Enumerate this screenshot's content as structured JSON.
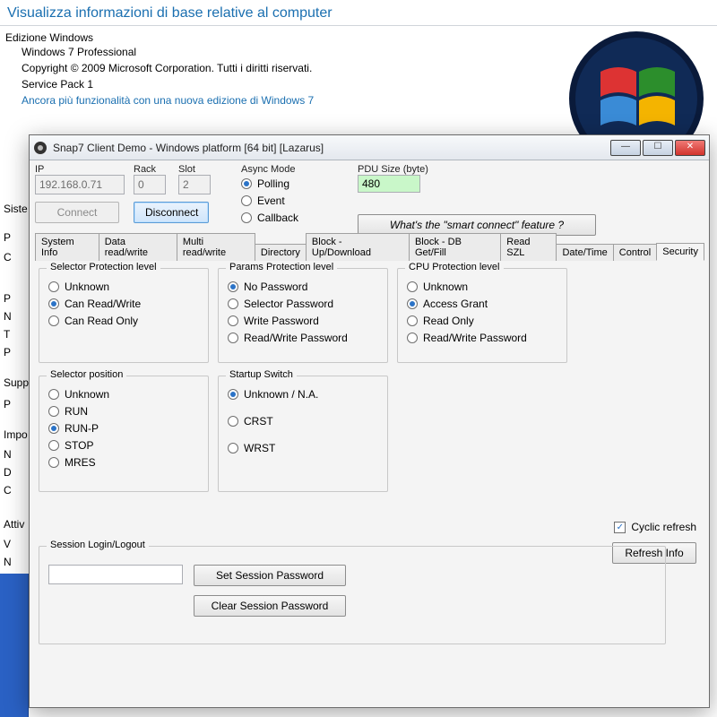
{
  "bg": {
    "title": "Visualizza informazioni di base relative al computer",
    "edition_header": "Edizione Windows",
    "os": "Windows 7 Professional",
    "copyright": "Copyright © 2009 Microsoft Corporation. Tutti i diritti riservati.",
    "sp": "Service Pack 1",
    "more_link": "Ancora più funzionalità con una nuova edizione di Windows 7",
    "side": [
      "Siste",
      "P",
      "C",
      "P",
      "N",
      "T",
      "P",
      "Supp",
      "P",
      "Impo",
      "N",
      "D",
      "C",
      "Attiv",
      "V",
      "N"
    ]
  },
  "win": {
    "title": "Snap7 Client Demo - Windows platform [64 bit] [Lazarus]"
  },
  "toprow": {
    "ip_label": "IP",
    "ip_value": "192.168.0.71",
    "rack_label": "Rack",
    "rack_value": "0",
    "slot_label": "Slot",
    "slot_value": "2",
    "connect_label": "Connect",
    "disconnect_label": "Disconnect",
    "async_label": "Async Mode",
    "async_options": [
      "Polling",
      "Event",
      "Callback"
    ],
    "async_selected": 0,
    "pdu_label": "PDU Size (byte)",
    "pdu_value": "480",
    "smart_label": "What's the \"smart connect\" feature ?"
  },
  "tabs": {
    "items": [
      "System Info",
      "Data read/write",
      "Multi read/write",
      "Directory",
      "Block - Up/Download",
      "Block - DB Get/Fill",
      "Read SZL",
      "Date/Time",
      "Control",
      "Security"
    ],
    "active": 9
  },
  "security": {
    "selector_prot": {
      "legend": "Selector Protection level",
      "options": [
        "Unknown",
        "Can Read/Write",
        "Can Read Only"
      ],
      "selected": 1
    },
    "params_prot": {
      "legend": "Params Protection level",
      "options": [
        "No Password",
        "Selector Password",
        "Write Password",
        "Read/Write Password"
      ],
      "selected": 0
    },
    "cpu_prot": {
      "legend": "CPU Protection level",
      "options": [
        "Unknown",
        "Access Grant",
        "Read Only",
        "Read/Write Password"
      ],
      "selected": 1
    },
    "selector_pos": {
      "legend": "Selector position",
      "options": [
        "Unknown",
        "RUN",
        "RUN-P",
        "STOP",
        "MRES"
      ],
      "selected": 2
    },
    "startup": {
      "legend": "Startup Switch",
      "options": [
        "Unknown / N.A.",
        "CRST",
        "WRST"
      ],
      "selected": 0
    },
    "cyclic_label": "Cyclic refresh",
    "cyclic_checked": true,
    "refresh_label": "Refresh Info",
    "session": {
      "legend": "Session Login/Logout",
      "password_value": "",
      "set_label": "Set Session Password",
      "clear_label": "Clear Session Password"
    }
  }
}
